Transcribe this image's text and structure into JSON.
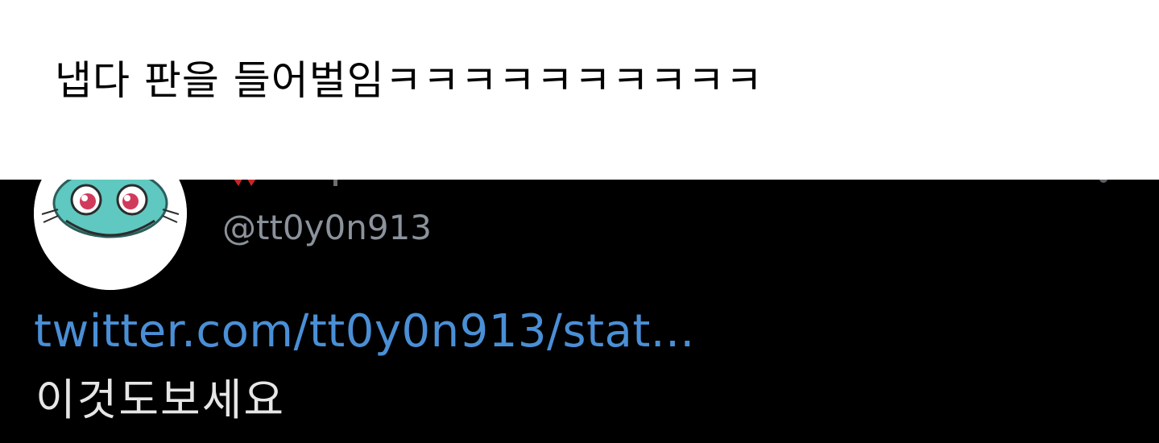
{
  "caption": {
    "text": "냅다 판을 들어벌임ㅋㅋㅋㅋㅋㅋㅋㅋㅋㅋ"
  },
  "tweet": {
    "handle": "@tt0y0n913",
    "link": "twitter.com/tt0y0n913/stat...",
    "body": "이것도보세요",
    "avatar_icon": "cartoon-creature-avatar",
    "more_icon": "more-options-icon"
  },
  "colors": {
    "caption_bg": "#ffffff",
    "caption_text": "#000000",
    "tweet_bg": "#000000",
    "handle": "#8b929b",
    "link": "#4a8fd6",
    "body": "#e6e6e6"
  }
}
